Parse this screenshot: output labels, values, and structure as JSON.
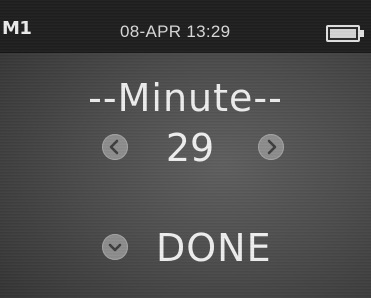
{
  "status_bar": {
    "profile": "M1",
    "datetime": "08-APR 13:29",
    "battery_icon": "battery-icon"
  },
  "editor": {
    "title": "--Minute--",
    "value": "29",
    "prev_icon": "chevron-left-icon",
    "next_icon": "chevron-right-icon"
  },
  "actions": {
    "done_label": "DONE",
    "done_icon": "chevron-down-icon"
  },
  "colors": {
    "background": "#4b4b4b",
    "status_bar": "#1f1f1f",
    "text": "#ececec",
    "button_circle": "#8d8d8d"
  }
}
